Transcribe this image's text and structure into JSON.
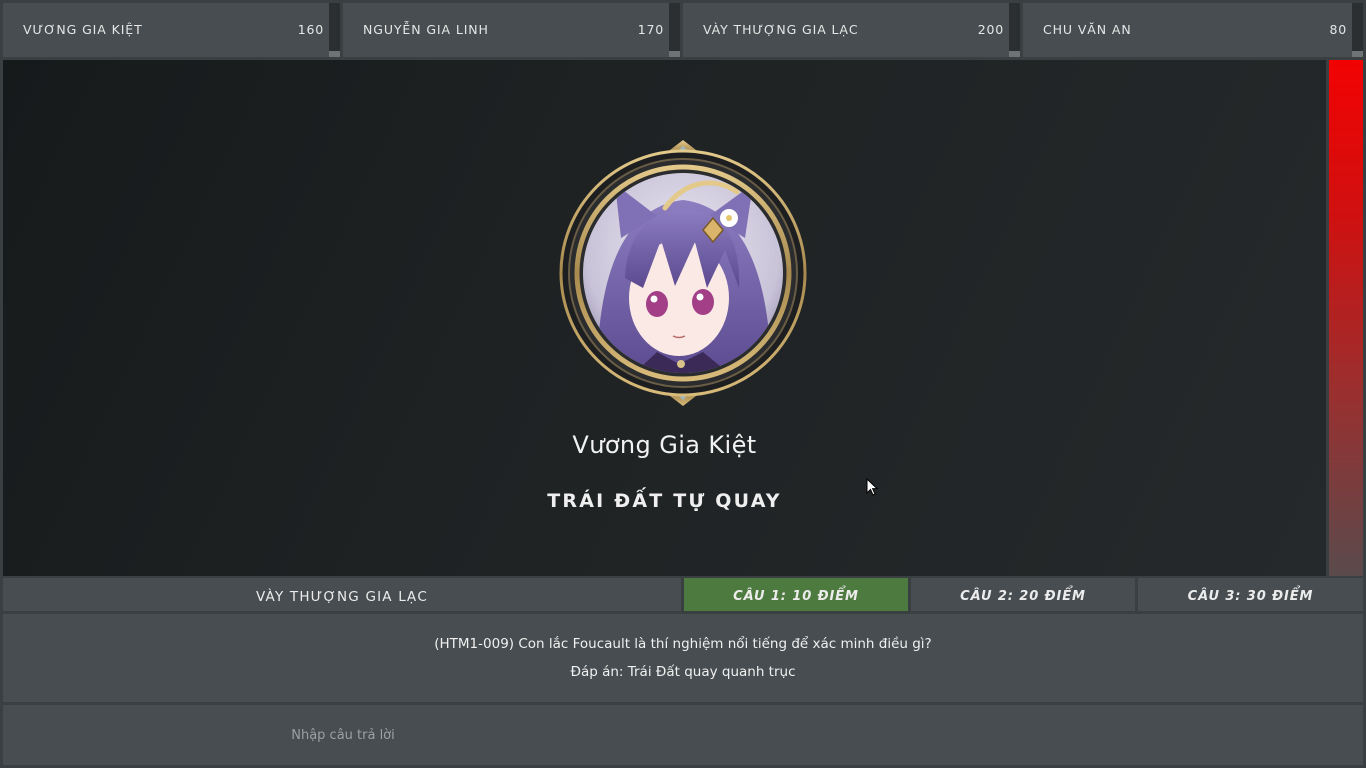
{
  "scoreboard": {
    "players": [
      {
        "name": "VƯƠNG GIA KIỆT",
        "score": "160"
      },
      {
        "name": "NGUYỄN GIA LINH",
        "score": "170"
      },
      {
        "name": "VÀY THƯỢNG GIA LẠC",
        "score": "200"
      },
      {
        "name": "CHU VĂN AN",
        "score": "80"
      }
    ]
  },
  "stage": {
    "contestant_name": "Vương Gia Kiệt",
    "answer": "TRÁI ĐẤT TỰ QUAY",
    "portrait_icon": "anime-girl-portrait"
  },
  "timer": {
    "remaining_fraction": 1.0,
    "color_top": "#f20202"
  },
  "question_bar": {
    "current_team": "VÀY THƯỢNG GIA LẠC",
    "tabs": [
      {
        "label": "CÂU 1: 10 ĐIỂM",
        "active": true
      },
      {
        "label": "CÂU 2: 20 ĐIỂM",
        "active": false
      },
      {
        "label": "CÂU 3: 30 ĐIỂM",
        "active": false
      }
    ],
    "active_color": "#4d7a3f"
  },
  "question": {
    "text": "(HTM1-009) Con lắc Foucault là thí nghiệm nổi tiếng để xác minh điều gì?",
    "answer_key": "Đáp án: Trái Đất quay quanh trục"
  },
  "input": {
    "placeholder": "Nhập câu trả lời",
    "value": ""
  },
  "colors": {
    "panel": "#474d50",
    "background": "#3a3f42",
    "stage": "#1e2223"
  }
}
